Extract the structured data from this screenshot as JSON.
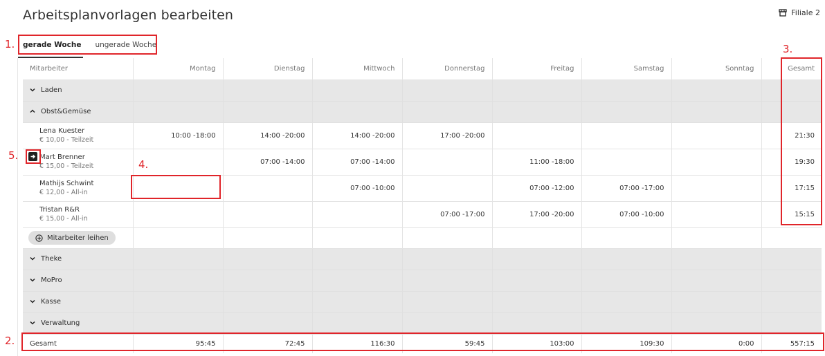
{
  "page": {
    "title": "Arbeitsplanvorlagen bearbeiten",
    "store": "Filiale 2"
  },
  "tabs": [
    {
      "label": "gerade Woche",
      "active": true
    },
    {
      "label": "ungerade Woche",
      "active": false
    }
  ],
  "table": {
    "headers": [
      "Mitarbeiter",
      "Montag",
      "Dienstag",
      "Mittwoch",
      "Donnerstag",
      "Freitag",
      "Samstag",
      "Sonntag",
      "Gesamt"
    ],
    "groups": {
      "laden": "Laden",
      "obst": "Obst&Gemüse",
      "theke": "Theke",
      "mopro": "MoPro",
      "kasse": "Kasse",
      "verwaltung": "Verwaltung"
    },
    "employees": [
      {
        "name": "Lena Kuester",
        "sub": "€ 10,00 - Teilzeit",
        "days": [
          "10:00 -18:00",
          "14:00 -20:00",
          "14:00 -20:00",
          "17:00 -20:00",
          "",
          "",
          ""
        ],
        "total": "21:30"
      },
      {
        "name": "Mart Brenner",
        "sub": "€ 15,00 - Teilzeit",
        "days": [
          "",
          "07:00 -14:00",
          "07:00 -14:00",
          "",
          "11:00 -18:00",
          "",
          ""
        ],
        "total": "19:30"
      },
      {
        "name": "Mathijs Schwint",
        "sub": "€ 12,00 - All-in",
        "days": [
          "",
          "",
          "07:00 -10:00",
          "",
          "07:00 -12:00",
          "07:00 -17:00",
          ""
        ],
        "total": "17:15"
      },
      {
        "name": "Tristan R&R",
        "sub": "€ 15,00 - All-in",
        "days": [
          "",
          "",
          "",
          "07:00 -17:00",
          "17:00 -20:00",
          "07:00 -10:00",
          ""
        ],
        "total": "15:15"
      }
    ],
    "lend_button": "Mitarbeiter leihen",
    "totals": {
      "label": "Gesamt",
      "values": [
        "95:45",
        "72:45",
        "116:30",
        "59:45",
        "103:00",
        "109:30",
        "0:00",
        "557:15"
      ]
    }
  },
  "annotations": [
    "1.",
    "2.",
    "3.",
    "4.",
    "5."
  ],
  "colors": {
    "annotation": "#e0252a",
    "group_bg": "#e7e7e7",
    "button_bg": "#dedede"
  },
  "icons": [
    "store-icon",
    "chevron-down-icon",
    "chevron-up-icon",
    "add-circle-icon",
    "arrow-right-icon"
  ]
}
